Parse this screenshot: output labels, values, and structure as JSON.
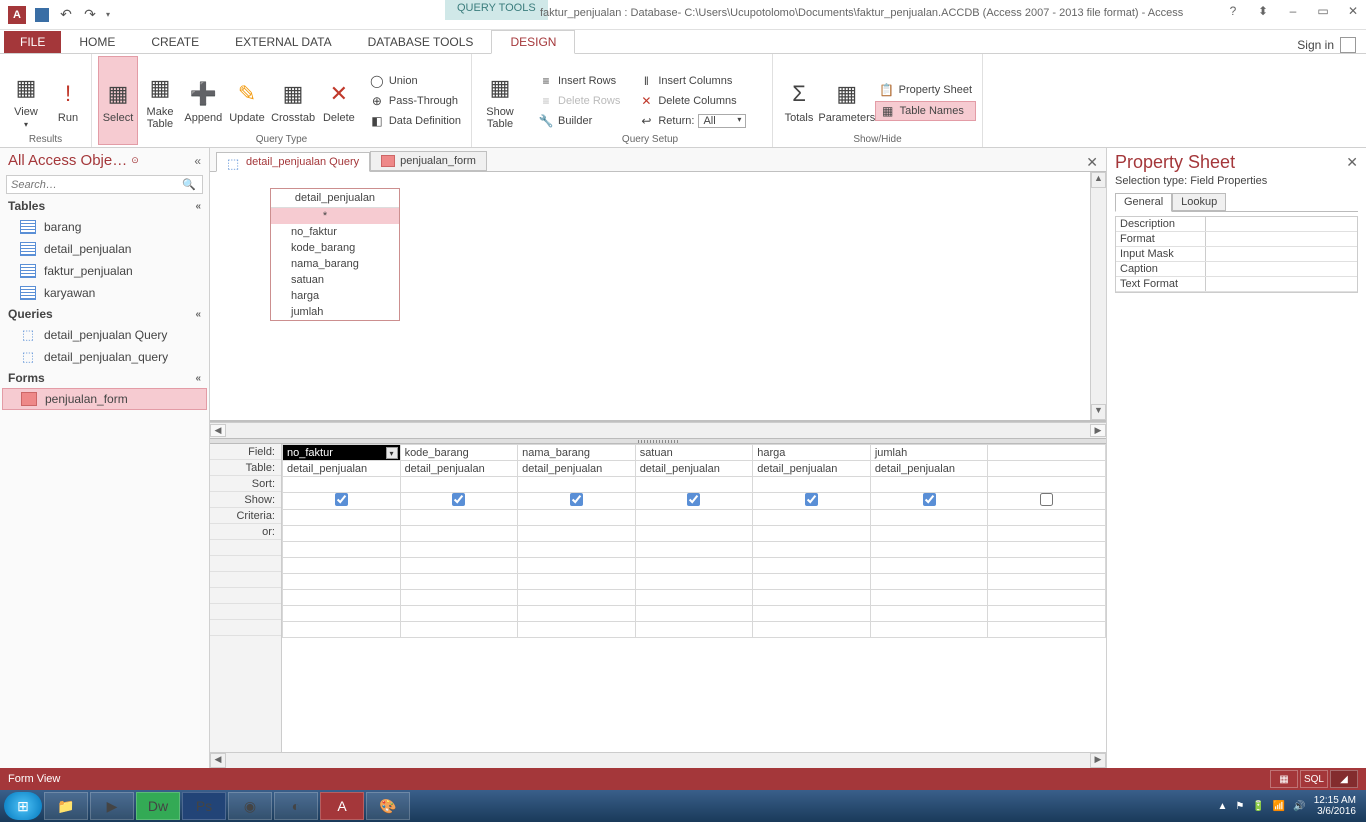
{
  "titlebar": {
    "context_tab": "QUERY TOOLS",
    "title": "faktur_penjualan : Database- C:\\Users\\Ucupotolomo\\Documents\\faktur_penjualan.ACCDB (Access 2007 - 2013 file format) - Access",
    "help": "?",
    "restore": "▭",
    "minimize": "–",
    "close": "✕"
  },
  "ribbon_tabs": {
    "file": "FILE",
    "items": [
      "HOME",
      "CREATE",
      "EXTERNAL DATA",
      "DATABASE TOOLS",
      "DESIGN"
    ],
    "active": "DESIGN",
    "signin": "Sign in"
  },
  "ribbon": {
    "results": {
      "label": "Results",
      "view": "View",
      "run": "Run"
    },
    "query_type": {
      "label": "Query Type",
      "select": "Select",
      "make_table": "Make\nTable",
      "append": "Append",
      "update": "Update",
      "crosstab": "Crosstab",
      "delete": "Delete",
      "union": "Union",
      "passthrough": "Pass-Through",
      "datadef": "Data Definition"
    },
    "show_table": "Show\nTable",
    "query_setup": {
      "label": "Query Setup",
      "insert_rows": "Insert Rows",
      "delete_rows": "Delete Rows",
      "builder": "Builder",
      "insert_cols": "Insert Columns",
      "delete_cols": "Delete Columns",
      "return": "Return:",
      "return_val": "All"
    },
    "showhide": {
      "label": "Show/Hide",
      "totals": "Totals",
      "parameters": "Parameters",
      "property_sheet": "Property Sheet",
      "table_names": "Table Names"
    }
  },
  "nav": {
    "title": "All Access Obje…",
    "search_placeholder": "Search…",
    "groups": {
      "tables": {
        "label": "Tables",
        "items": [
          "barang",
          "detail_penjualan",
          "faktur_penjualan",
          "karyawan"
        ]
      },
      "queries": {
        "label": "Queries",
        "items": [
          "detail_penjualan Query",
          "detail_penjualan_query"
        ]
      },
      "forms": {
        "label": "Forms",
        "items": [
          "penjualan_form"
        ]
      }
    }
  },
  "doc_tabs": {
    "items": [
      "detail_penjualan Query",
      "penjualan_form"
    ],
    "active": 0
  },
  "fieldlist": {
    "title": "detail_penjualan",
    "fields": [
      "*",
      "no_faktur",
      "kode_barang",
      "nama_barang",
      "satuan",
      "harga",
      "jumlah"
    ],
    "selected": 0
  },
  "qgrid": {
    "labels": [
      "Field:",
      "Table:",
      "Sort:",
      "Show:",
      "Criteria:",
      "or:"
    ],
    "cols": [
      {
        "field": "no_faktur",
        "table": "detail_penjualan",
        "show": true,
        "active": true
      },
      {
        "field": "kode_barang",
        "table": "detail_penjualan",
        "show": true
      },
      {
        "field": "nama_barang",
        "table": "detail_penjualan",
        "show": true
      },
      {
        "field": "satuan",
        "table": "detail_penjualan",
        "show": true
      },
      {
        "field": "harga",
        "table": "detail_penjualan",
        "show": true
      },
      {
        "field": "jumlah",
        "table": "detail_penjualan",
        "show": true
      },
      {
        "field": "",
        "table": "",
        "show": false
      }
    ]
  },
  "propsheet": {
    "title": "Property Sheet",
    "subtitle": "Selection type:  Field Properties",
    "tabs": [
      "General",
      "Lookup"
    ],
    "props": [
      "Description",
      "Format",
      "Input Mask",
      "Caption",
      "Text Format"
    ]
  },
  "statusbar": {
    "left": "Form View",
    "sql": "SQL"
  },
  "taskbar": {
    "time": "12:15 AM",
    "date": "3/6/2016"
  }
}
